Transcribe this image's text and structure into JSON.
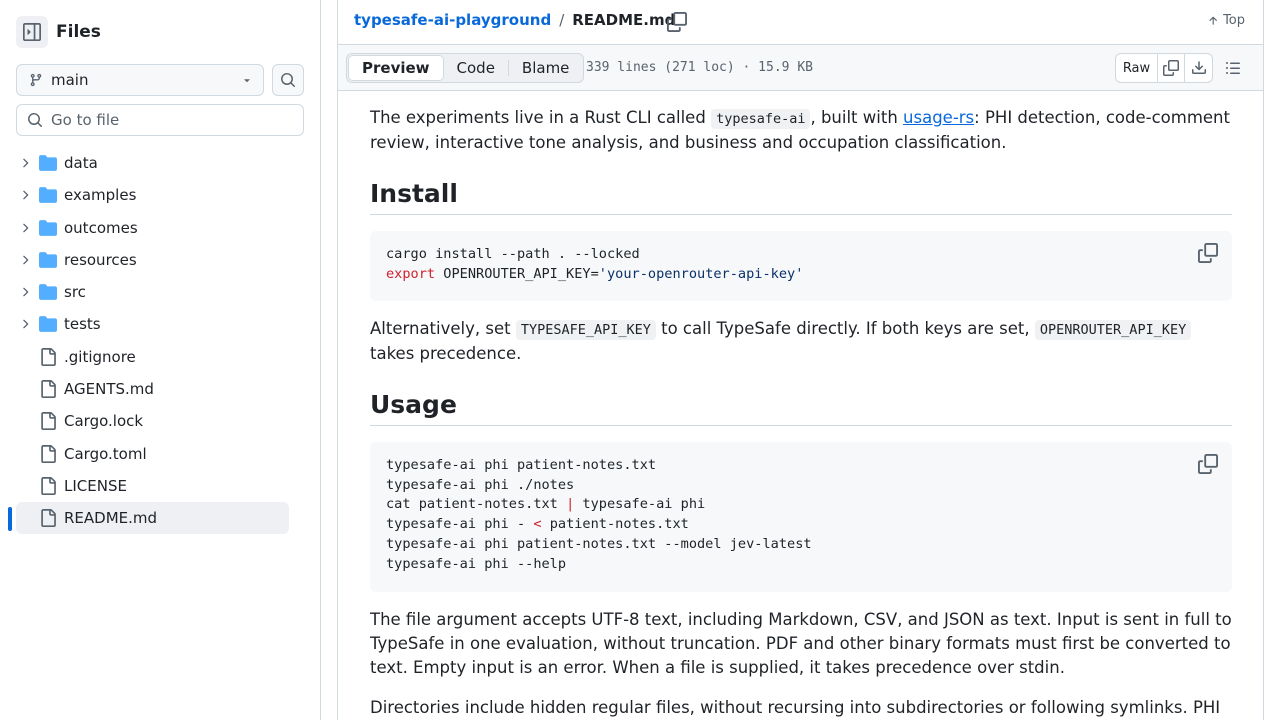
{
  "sidebar": {
    "title": "Files",
    "branch": "main",
    "goto_placeholder": "Go to file",
    "items": [
      {
        "name": "data",
        "type": "folder"
      },
      {
        "name": "examples",
        "type": "folder"
      },
      {
        "name": "outcomes",
        "type": "folder"
      },
      {
        "name": "resources",
        "type": "folder"
      },
      {
        "name": "src",
        "type": "folder"
      },
      {
        "name": "tests",
        "type": "folder"
      },
      {
        "name": ".gitignore",
        "type": "file"
      },
      {
        "name": "AGENTS.md",
        "type": "file"
      },
      {
        "name": "Cargo.lock",
        "type": "file"
      },
      {
        "name": "Cargo.toml",
        "type": "file"
      },
      {
        "name": "LICENSE",
        "type": "file"
      },
      {
        "name": "README.md",
        "type": "file",
        "selected": true
      }
    ]
  },
  "header": {
    "repo": "typesafe-ai-playground",
    "separator": "/",
    "file": "README.md",
    "top_label": "Top"
  },
  "toolbar": {
    "tabs": [
      "Preview",
      "Code",
      "Blame"
    ],
    "active_tab": "Preview",
    "file_info": "339 lines (271 loc) · 15.9 KB",
    "raw_label": "Raw"
  },
  "content": {
    "intro": {
      "t1": "The experiments live in a Rust CLI called ",
      "code": "typesafe-ai",
      "t2": ", built with ",
      "link": "usage-rs",
      "t3": ": PHI detection, code-comment review, interactive tone analysis, and business and occupation classification."
    },
    "install_heading": "Install",
    "install_code": {
      "line1": "cargo install --path . --locked",
      "line2_kw": "export",
      "line2_var": " OPENROUTER_API_KEY=",
      "line2_str": "'your-openrouter-api-key'"
    },
    "alt": {
      "t1": "Alternatively, set ",
      "code1": "TYPESAFE_API_KEY",
      "t2": " to call TypeSafe directly. If both keys are set, ",
      "code2": "OPENROUTER_API_KEY",
      "t3": " takes precedence."
    },
    "usage_heading": "Usage",
    "usage_code": {
      "l1": "typesafe-ai phi patient-notes.txt",
      "l2": "typesafe-ai phi ./notes",
      "l3a": "cat patient-notes.txt ",
      "l3op": "|",
      "l3b": " typesafe-ai phi",
      "l4a": "typesafe-ai phi - ",
      "l4op": "<",
      "l4b": " patient-notes.txt",
      "l5": "typesafe-ai phi patient-notes.txt --model jev-latest",
      "l6": "typesafe-ai phi --help"
    },
    "file_arg": "The file argument accepts UTF-8 text, including Markdown, CSV, and JSON as text. Input is sent in full to TypeSafe in one evaluation, without truncation. PDF and other binary formats must first be converted to text. Empty input is an error. When a file is supplied, it takes precedence over stdin.",
    "directories": "Directories include hidden regular files, without recursing into subdirectories or following symlinks. PHI"
  },
  "colors": {
    "accent": "#0969da",
    "border": "#d1d9e0",
    "folder": "#54aeff",
    "keyword": "#cf222e",
    "string": "#0a3069"
  }
}
